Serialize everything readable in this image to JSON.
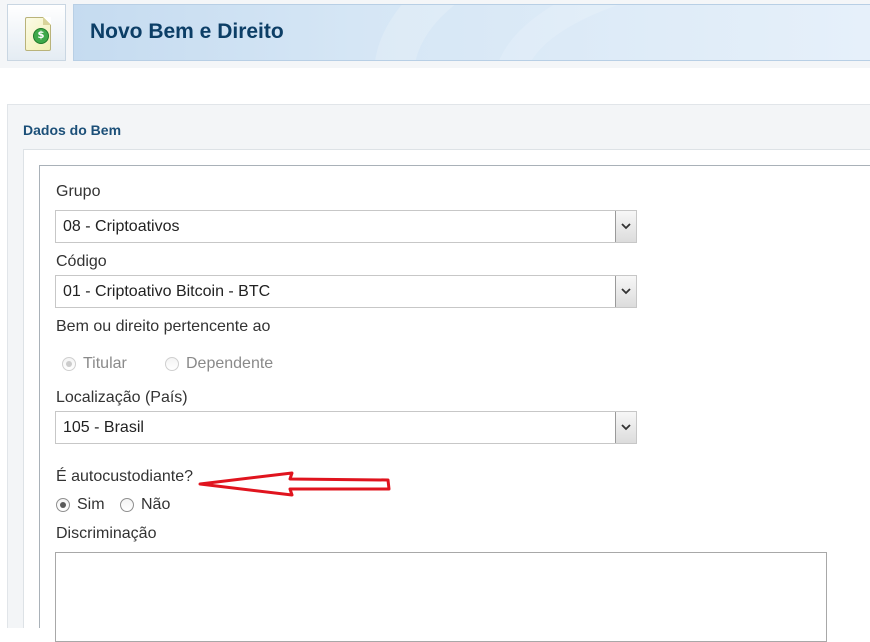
{
  "header": {
    "title": "Novo Bem e Direito",
    "logo_icon": "document-money-icon",
    "coin_symbol": "$"
  },
  "section": {
    "title": "Dados do Bem"
  },
  "form": {
    "grupo": {
      "label": "Grupo",
      "value": "08 - Criptoativos"
    },
    "codigo": {
      "label": "Código",
      "value": "01 - Criptoativo Bitcoin - BTC"
    },
    "pertencente": {
      "label": "Bem ou direito pertencente ao",
      "options": [
        "Titular",
        "Dependente"
      ],
      "selected": "Titular",
      "disabled": true
    },
    "localizacao": {
      "label": "Localização (País)",
      "value": "105 - Brasil"
    },
    "autocustodiante": {
      "label": "É autocustodiante?",
      "options": [
        "Sim",
        "Não"
      ],
      "selected": "Sim"
    },
    "discriminacao": {
      "label": "Discriminação",
      "value": ""
    }
  },
  "annotation": {
    "arrow_color": "#e0141e",
    "arrow_icon": "red-arrow-annotation"
  }
}
